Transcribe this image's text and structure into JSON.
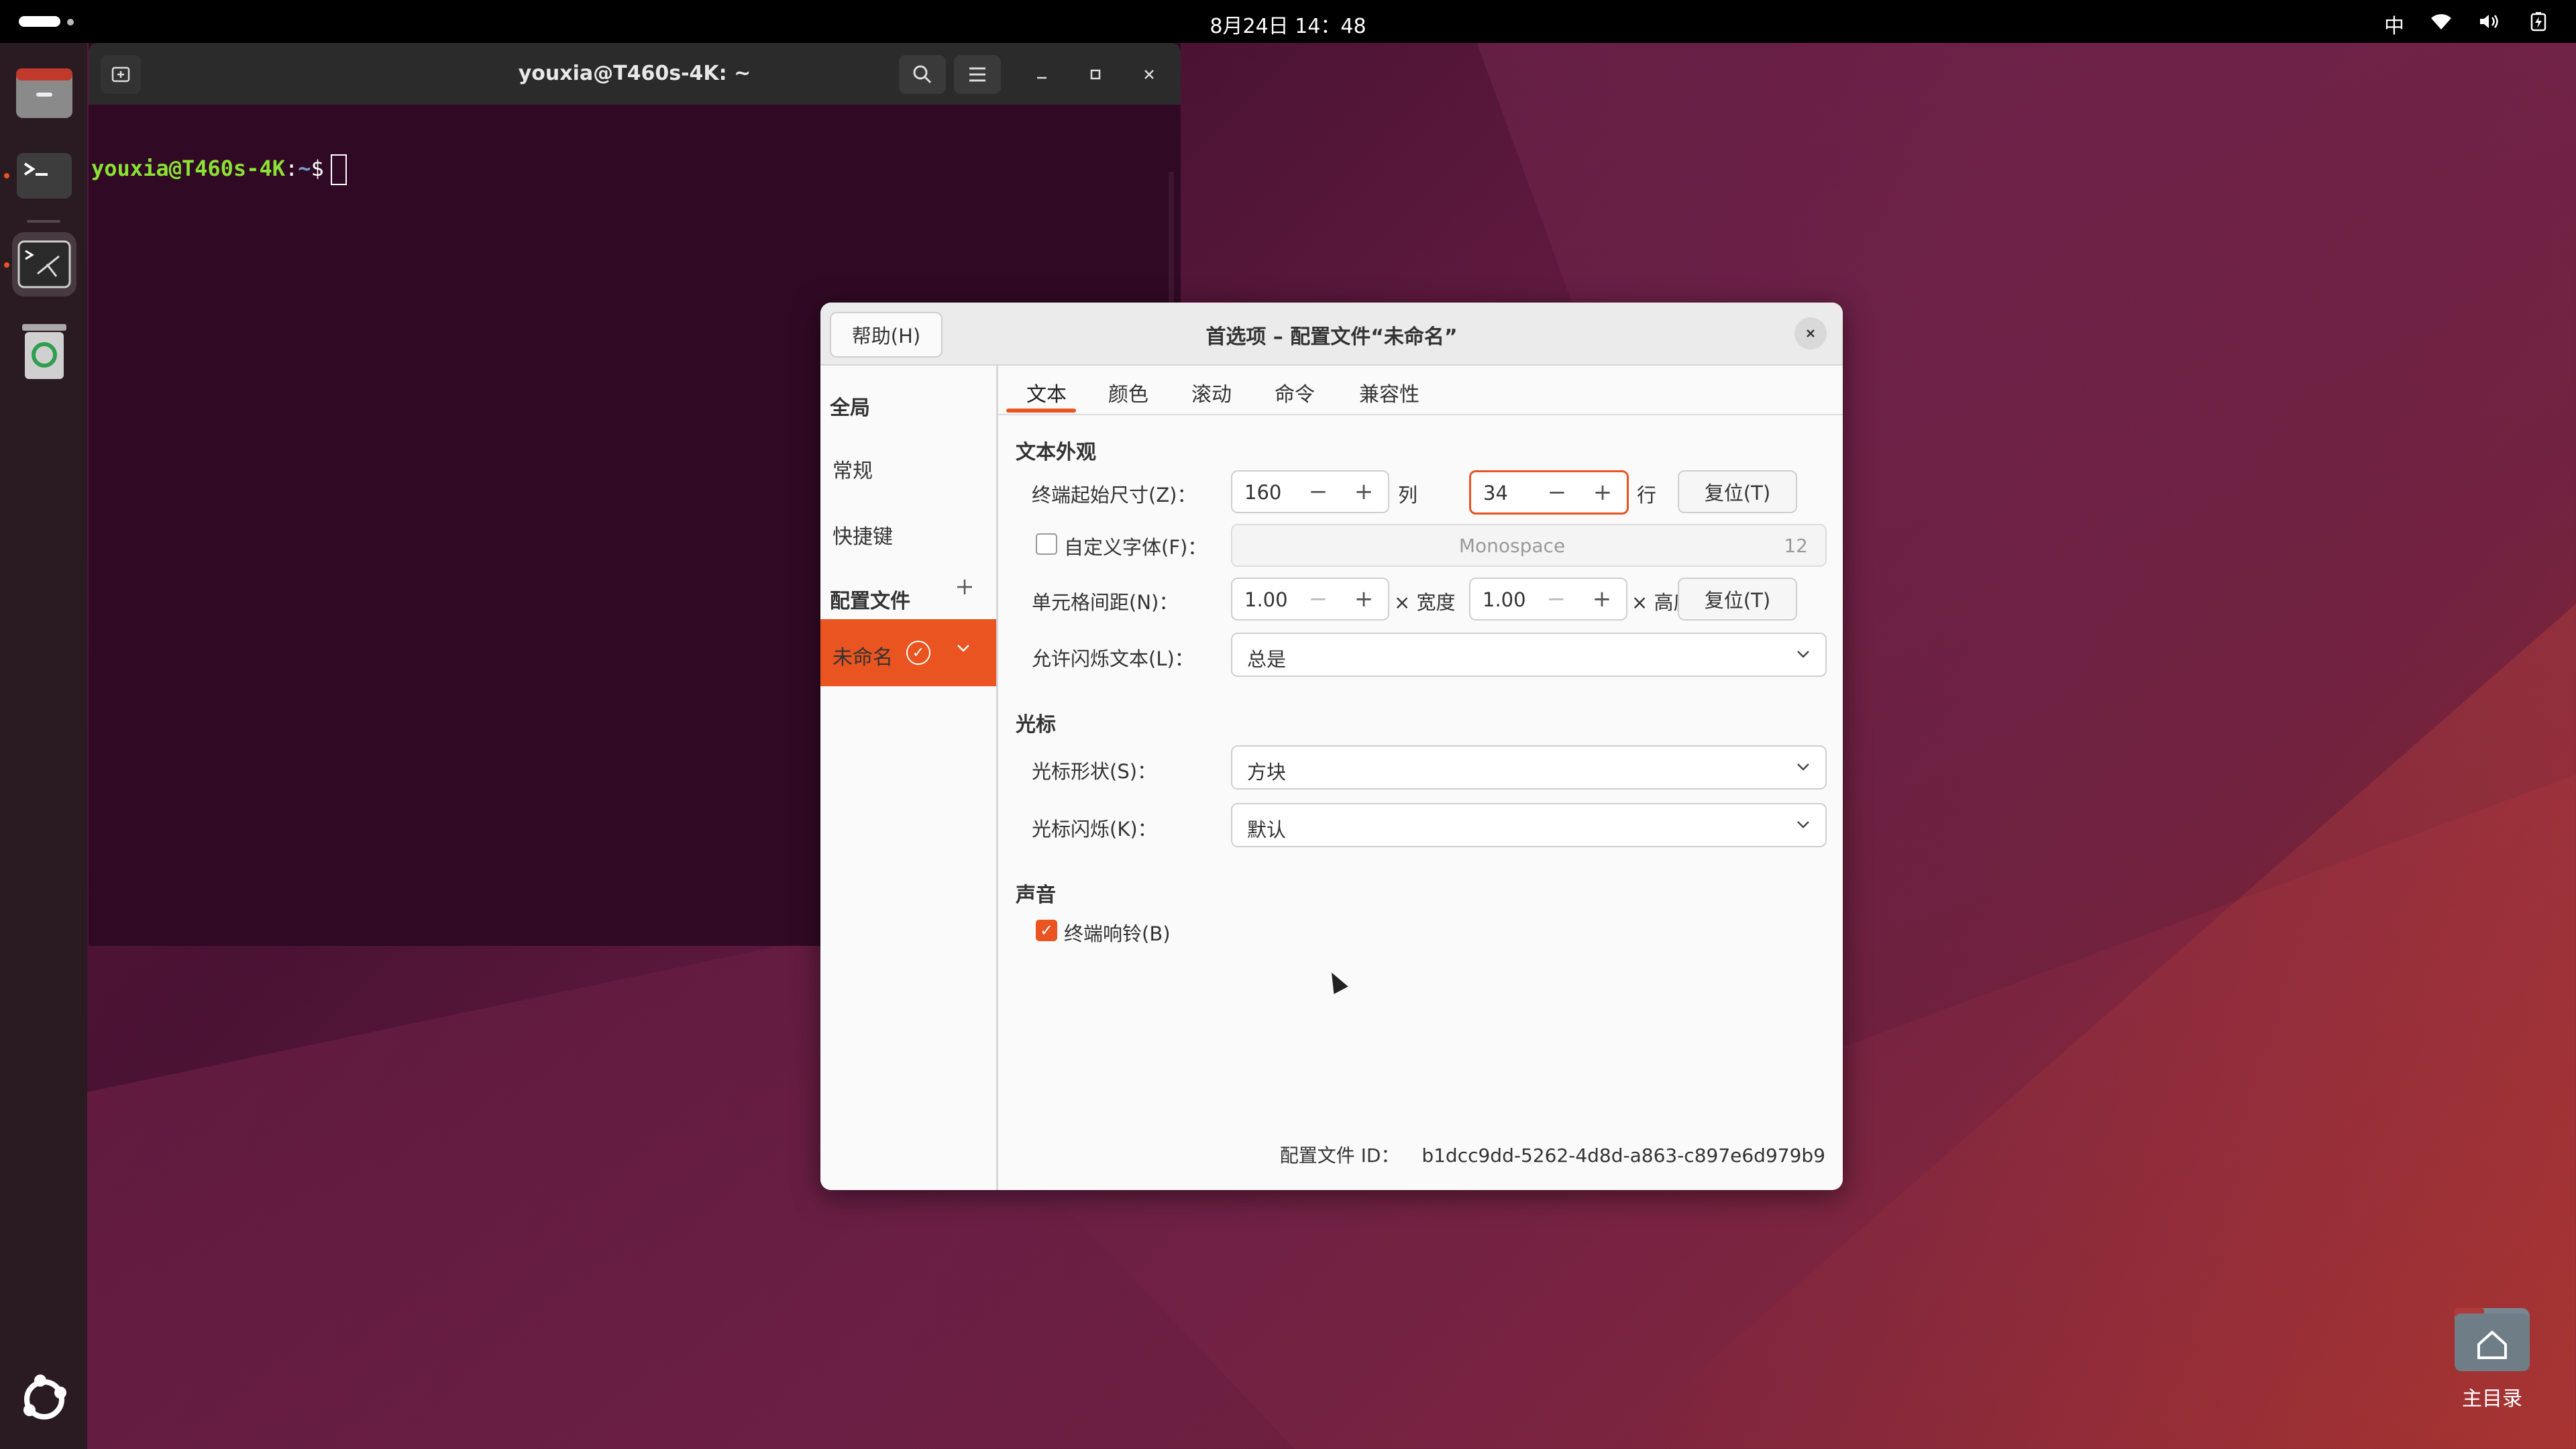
{
  "topbar": {
    "clock": "8月24日 14：48",
    "ime": "中"
  },
  "terminal": {
    "title": "youxia@T460s-4K: ~",
    "prompt_user": "youxia@T460s-4K",
    "prompt_sep": ":",
    "prompt_path": "~",
    "prompt_symbol": "$"
  },
  "dialog": {
    "help": "帮助(H)",
    "title": "首选项 – 配置文件“未命名”",
    "sidebar": {
      "global": "全局",
      "general": "常规",
      "shortcuts": "快捷键",
      "profiles": "配置文件",
      "profile_name": "未命名"
    },
    "tabs": [
      "文本",
      "颜色",
      "滚动",
      "命令",
      "兼容性"
    ],
    "text_appearance": {
      "section": "文本外观",
      "size_label": "终端起始尺寸(Z)：",
      "cols_value": "160",
      "cols_unit": "列",
      "rows_value": "34",
      "rows_unit": "行",
      "reset": "复位(T)",
      "custom_font_label": "自定义字体(F)：",
      "font_name": "Monospace",
      "font_size": "12",
      "spacing_label": "单元格间距(N)：",
      "width_value": "1.00",
      "width_unit": "× 宽度",
      "height_value": "1.00",
      "height_unit": "× 高度",
      "reset2": "复位(T)",
      "blink_label": "允许闪烁文本(L)：",
      "blink_value": "总是"
    },
    "cursor": {
      "section": "光标",
      "shape_label": "光标形状(S)：",
      "shape_value": "方块",
      "blink_label": "光标闪烁(K)：",
      "blink_value": "默认"
    },
    "sound": {
      "section": "声音",
      "bell_label": "终端响铃(B)"
    },
    "profile_id_label": "配置文件 ID：",
    "profile_id": "b1dcc9dd-5262-4d8d-a863-c897e6d979b9"
  },
  "desktop": {
    "home_label": "主目录"
  },
  "colors": {
    "accent": "#e95420",
    "terminal_bg": "#300a24"
  }
}
